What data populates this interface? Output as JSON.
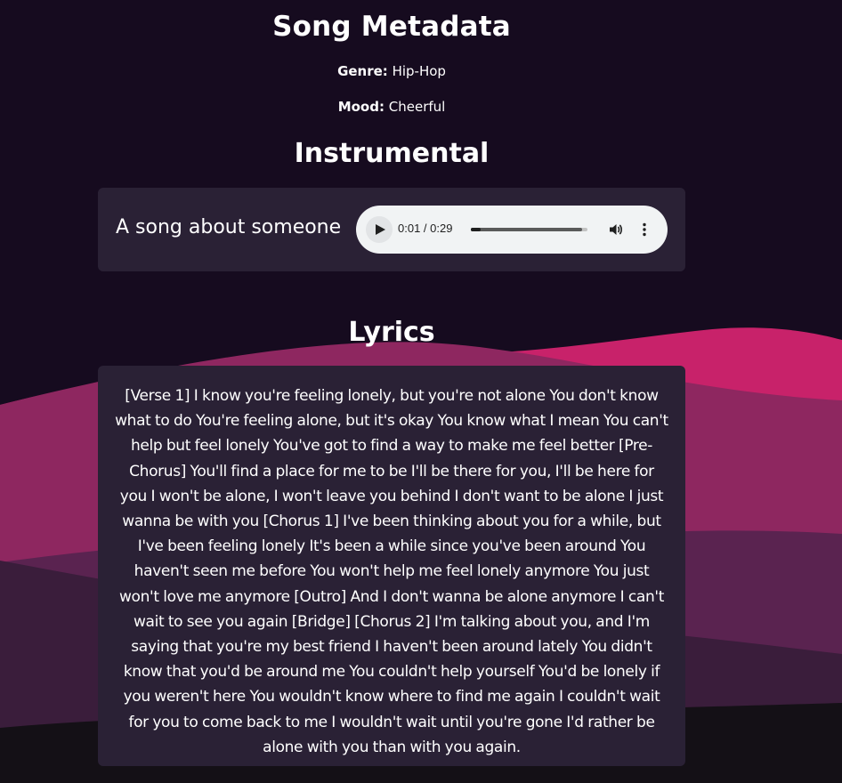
{
  "metadata": {
    "title": "Song Metadata",
    "genre_label": "Genre:",
    "genre_value": "Hip-Hop",
    "mood_label": "Mood:",
    "mood_value": "Cheerful"
  },
  "instrumental": {
    "heading": "Instrumental",
    "track_name": "A song about someone",
    "player": {
      "time": "0:01 / 0:29",
      "progress": 0.034,
      "icons": [
        "play-icon",
        "volume-icon",
        "more-vertical-icon"
      ]
    }
  },
  "lyrics": {
    "heading": "Lyrics",
    "text": "[Verse 1] I know you're feeling lonely, but you're not alone You don't know what to do You're feeling alone, but it's okay You know what I mean You can't help but feel lonely You've got to find a way to make me feel better [Pre-Chorus] You'll find a place for me to be I'll be there for you, I'll be here for you I won't be alone, I won't leave you behind I don't want to be alone I just wanna be with you [Chorus 1] I've been thinking about you for a while, but I've been feeling lonely It's been a while since you've been around You haven't seen me before You won't help me feel lonely anymore You just won't love me anymore [Outro] And I don't wanna be alone anymore I can't wait to see you again [Bridge] [Chorus 2] I'm talking about you, and I'm saying that you're my best friend I haven't been around lately You didn't know that you'd be around me You couldn't help yourself You'd be lonely if you weren't here You wouldn't know where to find me again I couldn't wait for you to come back to me I wouldn't wait until you're gone I'd rather be alone with you than with you again."
  },
  "colors": {
    "background": "#160b1f",
    "card": "#2a2135",
    "wave_pink": "#c8226a",
    "wave_magenta": "#8e2760",
    "wave_plum": "#5a2350",
    "wave_dark": "#3a1d3b"
  }
}
